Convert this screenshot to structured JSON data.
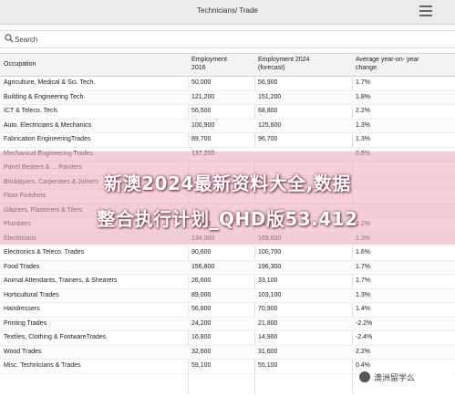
{
  "header": {
    "title": "Technicians/ Trade"
  },
  "search": {
    "placeholder": "Search"
  },
  "table": {
    "columns": [
      "Occupation",
      "Employment\n2016",
      "Employment 2024\n(forecast)",
      "Average year-on- year\nchange"
    ],
    "rows": [
      [
        "Agriculture, Medical & Sci. Tech.",
        "50,000",
        "56,900",
        "1.7%"
      ],
      [
        "Building & Engineering Tech.",
        "121,200",
        "151,200",
        "1.8%"
      ],
      [
        "ICT & Teleco. Tech.",
        "56,500",
        "68,800",
        "2.2%"
      ],
      [
        "Auto. Electricians & Mechanics",
        "100,900",
        "125,600",
        "1.3%"
      ],
      [
        "Fabrication EngineeringTrades",
        "89,700",
        "96,700",
        "1.3%"
      ],
      [
        "Mechanical Engineering Trades",
        "137,200",
        "",
        "0.8%"
      ],
      [
        "Panel Beaters & ... Painters",
        "",
        "",
        ""
      ],
      [
        "Bricklayers, Carpenters & Joiners",
        "",
        "",
        ""
      ],
      [
        "Floor Finishers",
        "",
        "",
        ""
      ],
      [
        "Glaziers, Plasterers & Tilers",
        "",
        "",
        ""
      ],
      [
        "Plumbers",
        "79,600",
        "94,600",
        "2.2%"
      ],
      [
        "Electricians",
        "134,000",
        "169,600",
        "1.3%"
      ],
      [
        "Electronics & Teleco. Trades",
        "90,600",
        "100,700",
        "1.6%"
      ],
      [
        "Food Trades",
        "156,800",
        "196,300",
        "1.7%"
      ],
      [
        "Animal Attendants, Trainers, & Shearers",
        "26,600",
        "33,100",
        "1.7%"
      ],
      [
        "Horticultural Trades",
        "89,000",
        "103,100",
        "1.3%"
      ],
      [
        "Hairdressers",
        "56,800",
        "70,900",
        "1.4%"
      ],
      [
        "Printing Trades",
        "24,200",
        "21,800",
        "-2.2%"
      ],
      [
        "Textiles, Clothing & FootwareTrades",
        "16,800",
        "14,900",
        "-2.4%"
      ],
      [
        "Wood Trades",
        "32,600",
        "31,600",
        "2.2%"
      ],
      [
        "Misc. Technicians & Trades",
        "59,100",
        "55,100",
        "0.4%"
      ]
    ]
  },
  "overlay": {
    "line1": "新澳2024最新资料大全,数据",
    "line2": "整合执行计划_QHD版53.412"
  },
  "watermark": {
    "text": "澳洲留学么"
  },
  "colors": {
    "header_bg": "#f1f3f5",
    "overlay": "#ecaab6"
  }
}
